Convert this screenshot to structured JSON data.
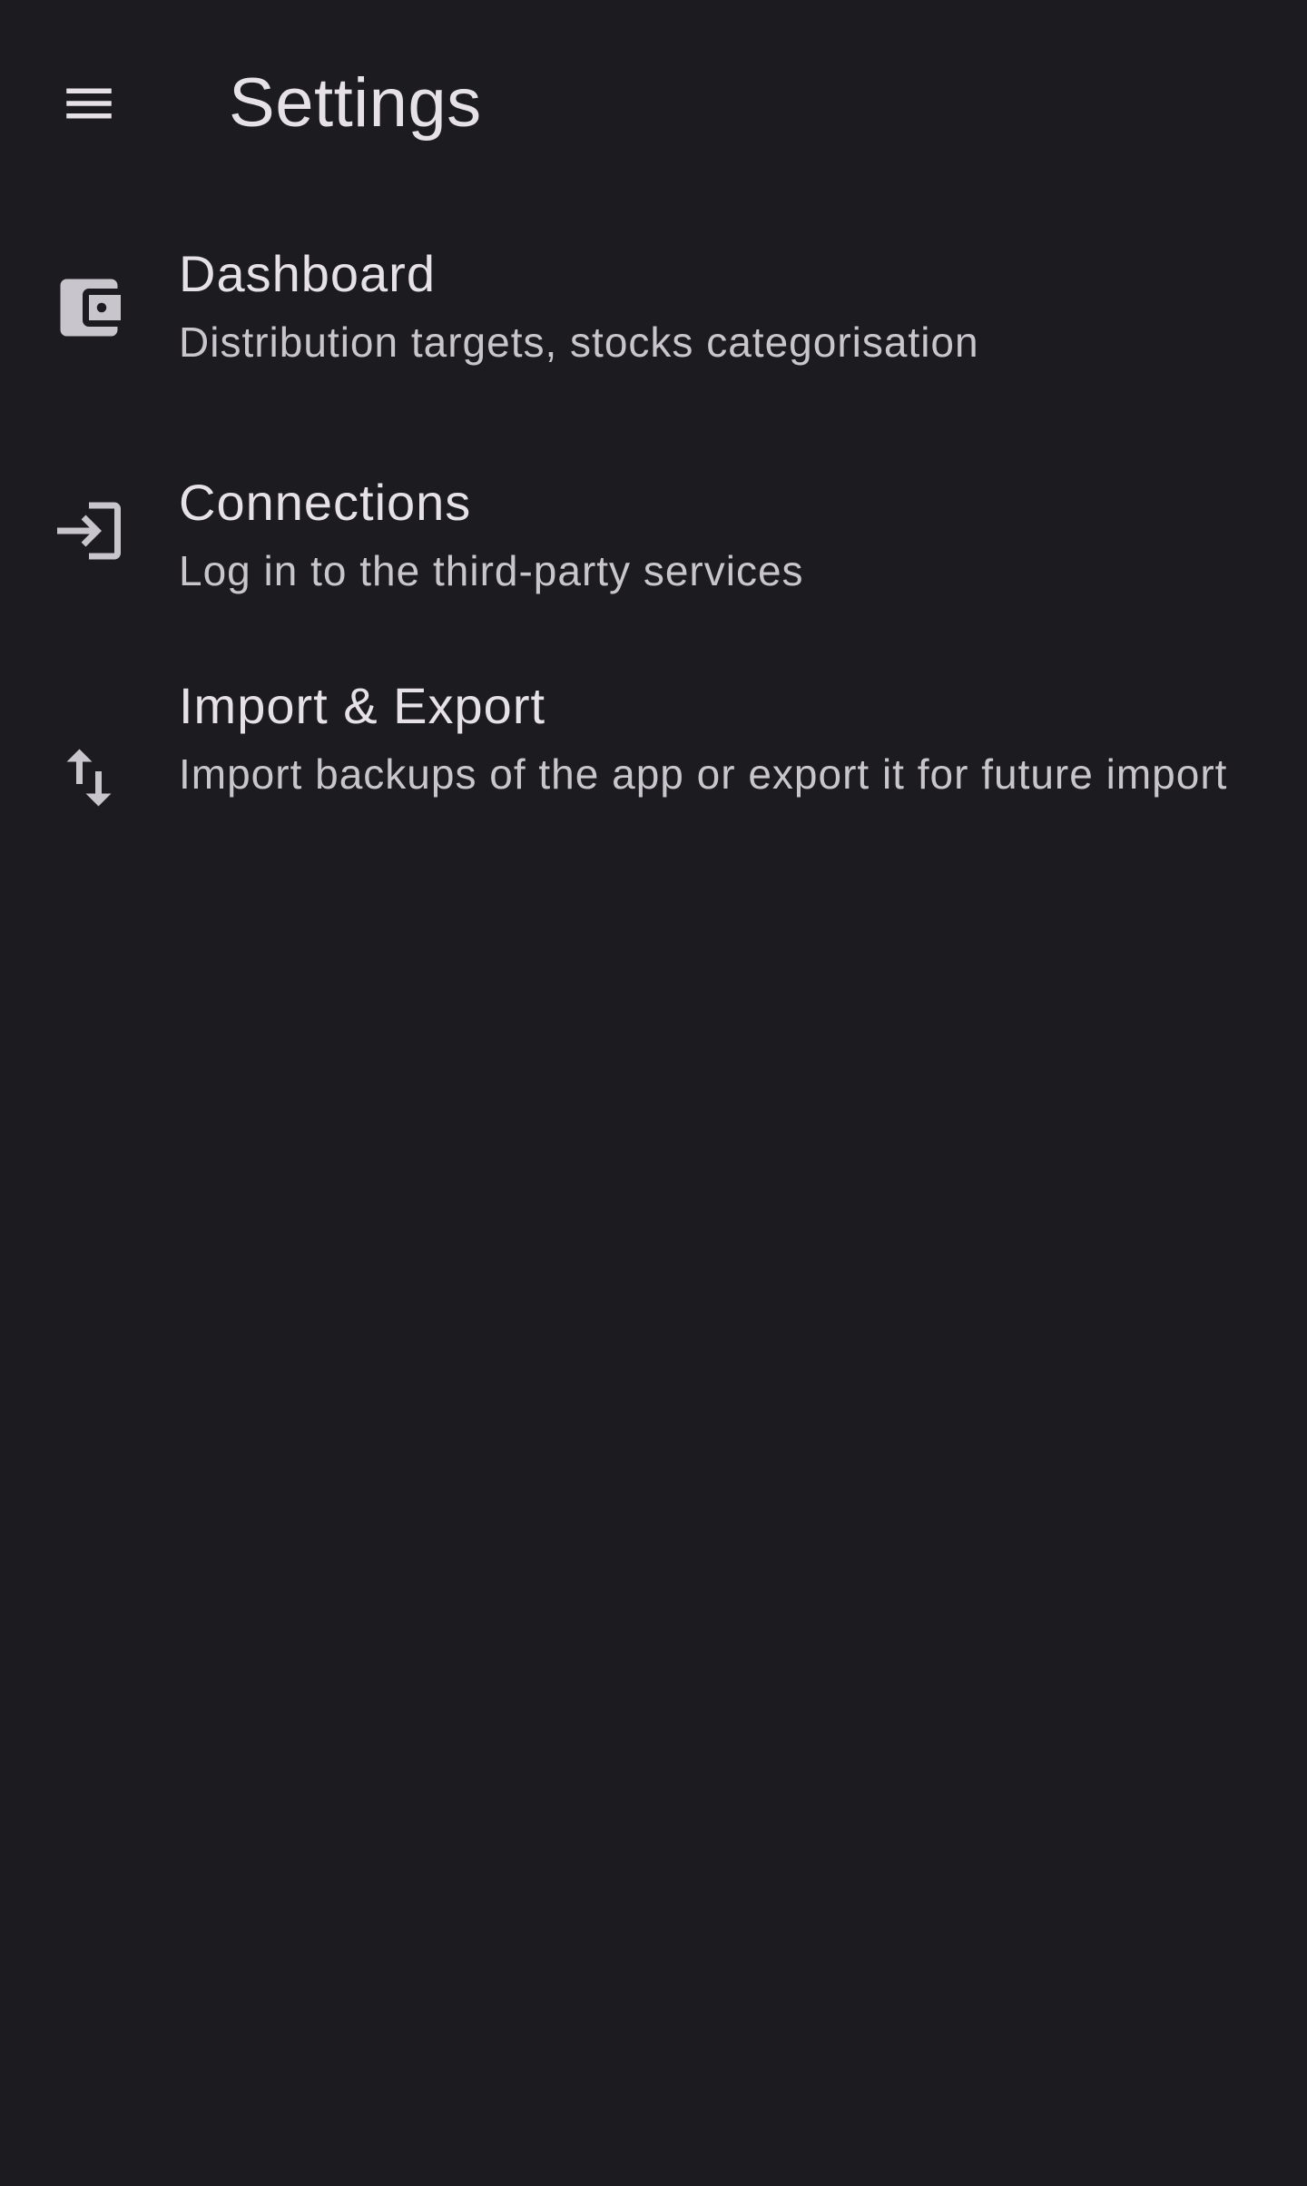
{
  "header": {
    "title": "Settings",
    "menu_icon": "menu-icon"
  },
  "settings": {
    "items": [
      {
        "icon": "wallet-icon",
        "title": "Dashboard",
        "subtitle": "Distribution targets, stocks categorisation"
      },
      {
        "icon": "login-icon",
        "title": "Connections",
        "subtitle": "Log in to the third-party services"
      },
      {
        "icon": "import-export-icon",
        "title": "Import & Export",
        "subtitle": "Import backups of the app or export it for future import"
      }
    ]
  },
  "colors": {
    "background": "#1c1b20",
    "text_primary": "#e6e1e6",
    "text_secondary": "#c9c5cc",
    "icon": "#c9c5cc"
  }
}
